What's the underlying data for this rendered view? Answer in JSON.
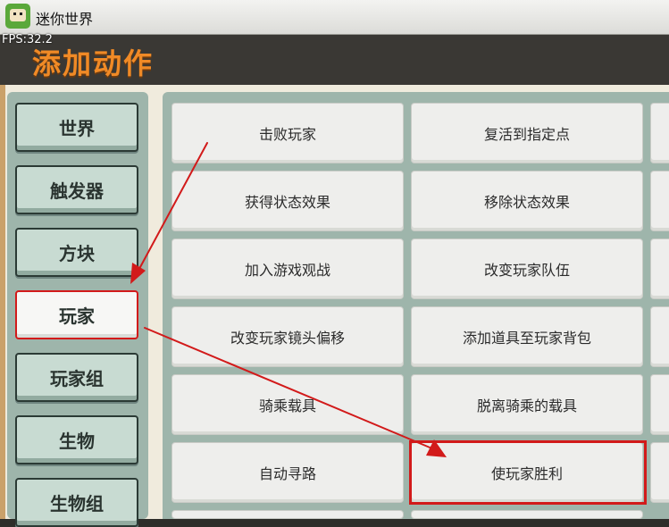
{
  "window": {
    "title": "迷你世界",
    "fps": "FPS:32.2"
  },
  "header": {
    "title": "添加动作"
  },
  "sidebar": {
    "items": [
      {
        "label": "世界"
      },
      {
        "label": "触发器"
      },
      {
        "label": "方块"
      },
      {
        "label": "玩家",
        "selected": true
      },
      {
        "label": "玩家组"
      },
      {
        "label": "生物"
      },
      {
        "label": "生物组"
      }
    ]
  },
  "actions": {
    "items": [
      "击败玩家",
      "复活到指定点",
      "获得状态效果",
      "移除状态效果",
      "加入游戏观战",
      "改变玩家队伍",
      "改变玩家镜头偏移",
      "添加道具至玩家背包",
      "骑乘载具",
      "脱离骑乘的载具",
      "自动寻路",
      "使玩家胜利"
    ],
    "highlighted": "使玩家胜利"
  },
  "colors": {
    "header_title": "#f08a26",
    "annotation": "#d21a1a",
    "panel": "#9eb5ab"
  }
}
